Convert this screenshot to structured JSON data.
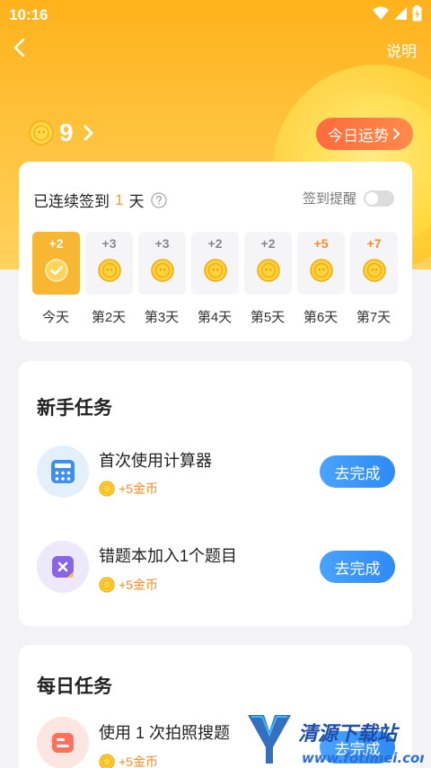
{
  "status_bar": {
    "time": "10:16"
  },
  "header": {
    "help_label": "说明"
  },
  "balance": {
    "amount": "9"
  },
  "fortune_button": {
    "label": "今日运势"
  },
  "checkin": {
    "streak_prefix": "已连续签到",
    "streak_days": "1",
    "streak_suffix": "天",
    "reminder_label": "签到提醒",
    "reminder_on": false,
    "days": [
      {
        "bonus": "+2",
        "label": "今天"
      },
      {
        "bonus": "+3",
        "label": "第2天"
      },
      {
        "bonus": "+3",
        "label": "第3天"
      },
      {
        "bonus": "+2",
        "label": "第4天"
      },
      {
        "bonus": "+2",
        "label": "第5天"
      },
      {
        "bonus": "+5",
        "label": "第6天"
      },
      {
        "bonus": "+7",
        "label": "第7天"
      }
    ]
  },
  "newbie_tasks": {
    "title": "新手任务",
    "items": [
      {
        "name": "首次使用计算器",
        "reward": "+5金币",
        "button": "去完成",
        "icon": "calculator-icon"
      },
      {
        "name": "错题本加入1个题目",
        "reward": "+5金币",
        "button": "去完成",
        "icon": "mistake-book-icon"
      }
    ]
  },
  "daily_tasks": {
    "title": "每日任务",
    "items": [
      {
        "name": "使用 1 次拍照搜题",
        "reward": "+5金币",
        "button": "去完成",
        "icon": "photo-search-icon"
      }
    ]
  },
  "watermark": {
    "name": "清源下载站",
    "url": "www.fotimei.com"
  },
  "colors": {
    "accent_orange": "#ff8a1e",
    "button_blue": "#2e8af5",
    "hero_yellow": "#ffb21a"
  }
}
